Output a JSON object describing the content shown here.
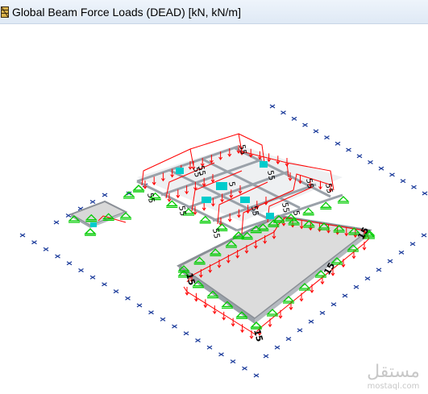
{
  "window": {
    "title": "Global Beam Force Loads (DEAD)  [kN,  kN/m]",
    "icon": "sap-structure-icon"
  },
  "load_labels": {
    "core_a": "55",
    "core_b": "55",
    "core_c": "55",
    "core_d": "55",
    "core_e": "55",
    "core_f": "5",
    "core_g": "55",
    "core_h": "55",
    "core_i": "55",
    "core_j": "55",
    "core_k": "55",
    "core_l": "55",
    "slab_top": "15",
    "slab_right": "15",
    "slab_left": "15",
    "slab_bottom": "15",
    "slab_corner": "5"
  },
  "watermark": {
    "arabic": "مستقل",
    "latin": "mostaql.com"
  },
  "colors": {
    "load_line": "#ff0000",
    "support": "#00cc00",
    "grid_marker": "#1a3a9a",
    "slab_fill": "#d8d8d8",
    "beam": "#9fa7b0",
    "accent": "#00cccc"
  }
}
